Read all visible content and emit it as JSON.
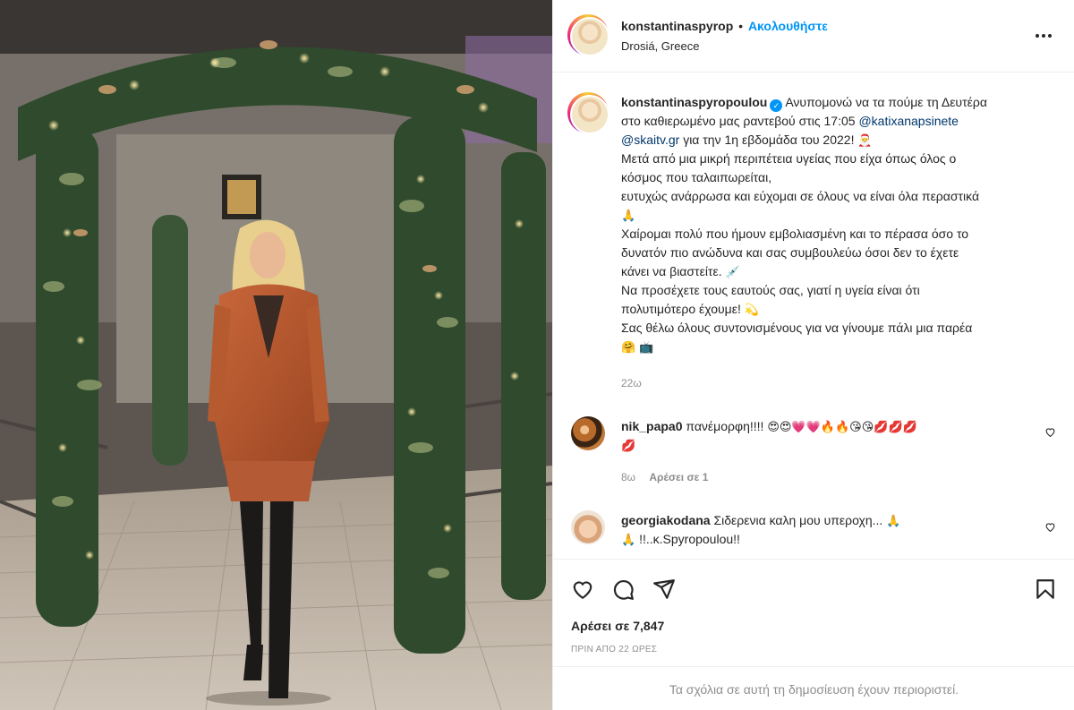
{
  "post": {
    "username": "konstantinaspyrop",
    "separator": "•",
    "follow_label": "Ακολουθήστε",
    "location": "Drosiá, Greece",
    "more_icon": "more-horizontal-icon"
  },
  "caption": {
    "username": "konstantinaspyropoulou",
    "verified_icon": "verified-badge-icon",
    "line1": "Ανυπομονώ να τα πούμε τη Δευτέρα",
    "line2_a": "στο καθιερωμένο μας ραντεβού στις 17:05",
    "mention1": "@katixanapsinete",
    "mention2": "@skaitv.gr",
    "line3_b": "για την 1η εβδομάδα του 2022!",
    "line4": "Μετά από μια μικρή περιπέτεια υγείας που είχα όπως όλος ο",
    "line5": "κόσμος που ταλαιπωρείται,",
    "line6": "ευτυχώς ανάρρωσα και εύχομαι σε όλους να είναι όλα περαστικά",
    "line7": "Χαίρομαι πολύ που ήμουν εμβολιασμένη και το πέρασα όσο το",
    "line8": "δυνατόν πιο ανώδυνα και σας συμβουλεύω όσοι δεν το έχετε",
    "line9": "κάνει να βιαστείτε.",
    "line10": "Να προσέχετε τους εαυτούς σας, γιατί η υγεία είναι ότι",
    "line11": "πολυτιμότερο έχουμε!",
    "line12": "Σας θέλω όλους συντονισμένους για να γίνουμε πάλι μια παρέα",
    "time": "22ω"
  },
  "comments": [
    {
      "username": "nik_papa0",
      "text": "πανέμορφη!!!!",
      "emojis1": "😍😍💗💗🔥🔥😘😘💋💋💋",
      "emojis2": "💋",
      "time": "8ω",
      "likes": "Αρέσει σε 1",
      "avatar_icon": "tiger-avatar"
    },
    {
      "username": "georgiakodana",
      "text": "Σιδερενια καλη μου υπεροχη...",
      "text2": "!!..κ.Spyropoulou!!",
      "avatar_icon": "profile-avatar"
    }
  ],
  "actions": {
    "like_icon": "heart-icon",
    "comment_icon": "comment-icon",
    "share_icon": "share-icon",
    "save_icon": "bookmark-icon",
    "likes": "Αρέσει σε 7,847",
    "posted": "ΠΡΙΝ ΑΠΟ 22 ΩΡΕΣ",
    "comments_limited": "Τα σχόλια σε αυτή τη δημοσίευση έχουν περιοριστεί."
  }
}
